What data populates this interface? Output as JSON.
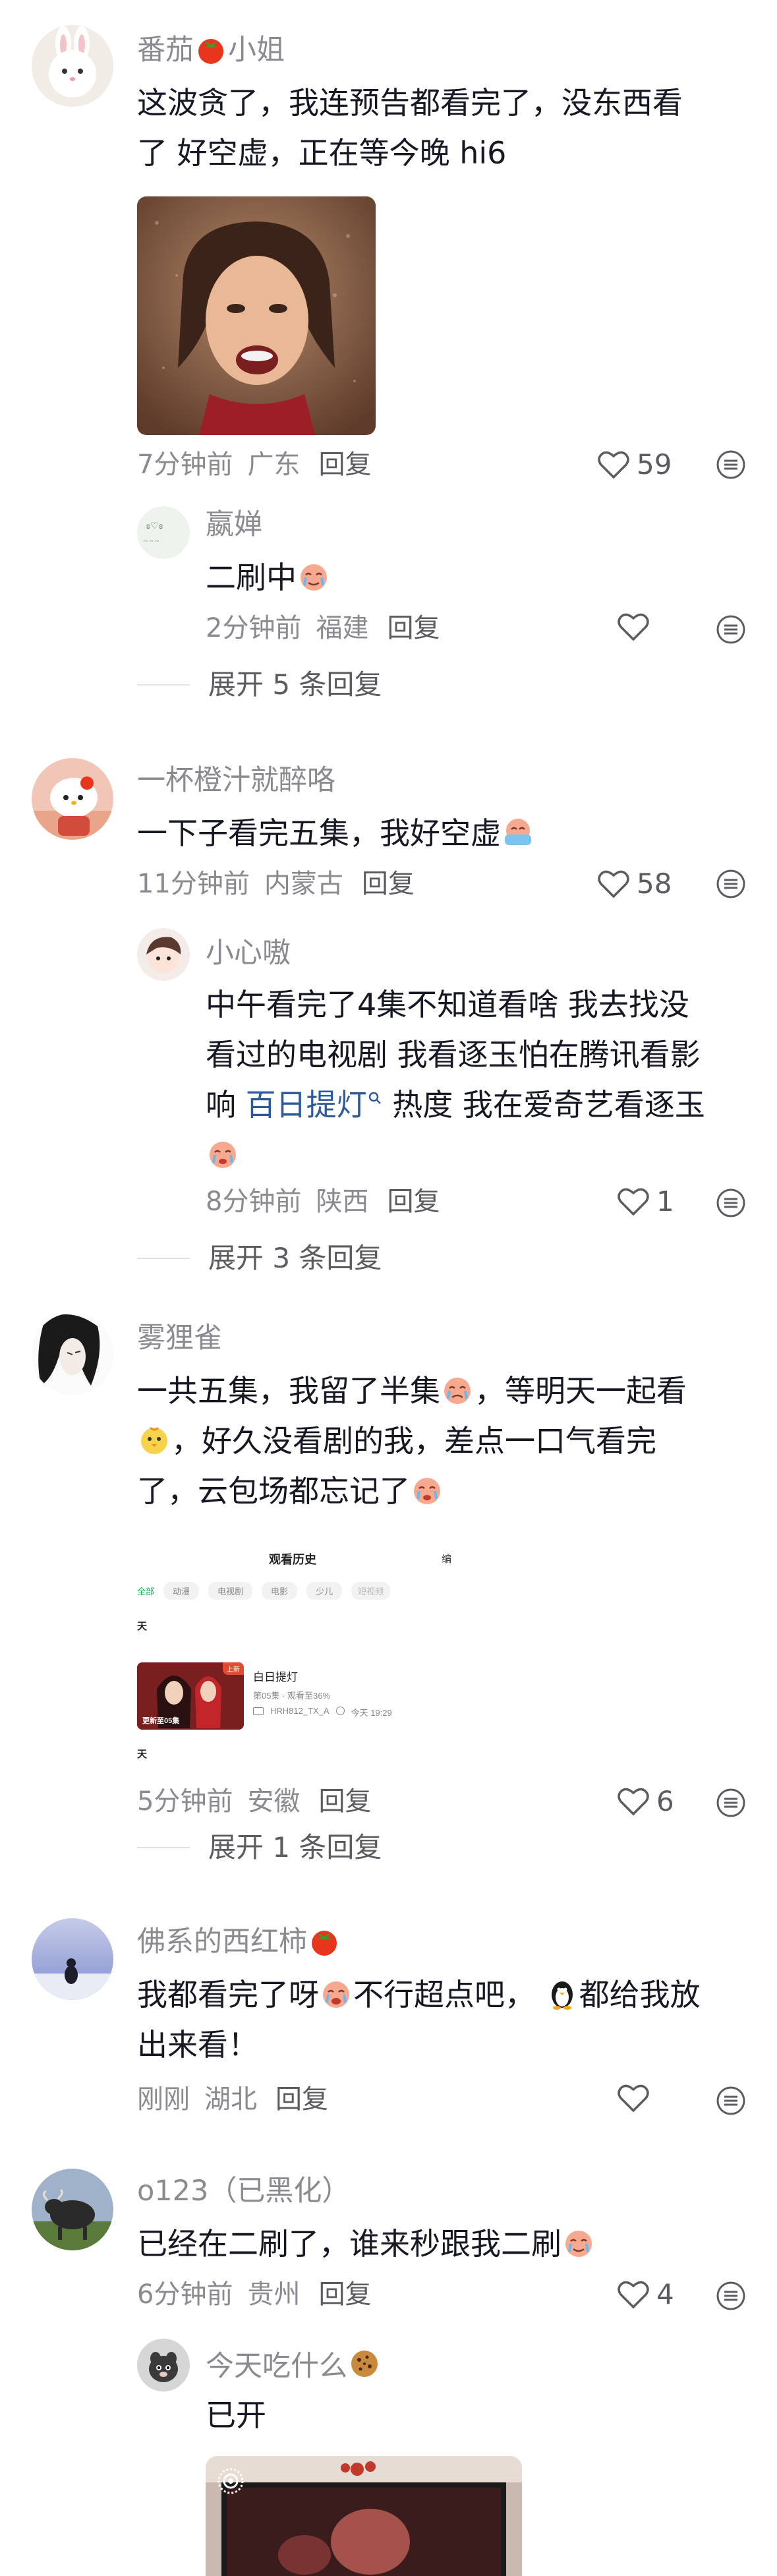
{
  "comments": [
    {
      "username": "番茄",
      "username_suffix": "小姐",
      "text_line1": "这波贪了，我连预告都看完了，没东西看",
      "text_line2": "了 好空虚，正在等今晚 hi6",
      "time": "7分钟前",
      "location": "广东",
      "reply_label": "回复",
      "likes": "59"
    },
    {
      "username": "一杯橙汁就醉咯",
      "text": "一下子看完五集，我好空虚",
      "time": "11分钟前",
      "location": "内蒙古",
      "reply_label": "回复",
      "likes": "58"
    },
    {
      "username": "雾狸雀",
      "text_line1": "一共五集，我留了半集",
      "text_line1b": "，等明天一起看",
      "text_line2": "，好久没看剧的我，差点一口气看完",
      "text_line3": "了，云包场都忘记了",
      "time": "5分钟前",
      "location": "安徽",
      "reply_label": "回复",
      "likes": "6"
    },
    {
      "username": "佛系的西红柿",
      "text_line1a": "我都看完了呀",
      "text_line1b": "不行超点吧，",
      "text_line1c": "都给我放",
      "text_line2": "出来看！",
      "time": "刚刚",
      "location": "湖北",
      "reply_label": "回复"
    },
    {
      "username": "o123（已黑化）",
      "text": "已经在二刷了，谁来秒跟我二刷",
      "time": "6分钟前",
      "location": "贵州",
      "reply_label": "回复",
      "likes": "4"
    }
  ],
  "replies": [
    {
      "username": "嬴婵",
      "text": "二刷中",
      "time": "2分钟前",
      "location": "福建",
      "reply_label": "回复"
    },
    {
      "username": "小心嗷",
      "text_line1": "中午看完了4集不知道看啥 我去找没",
      "text_line2": "看过的电视剧  我看逐玉怕在腾讯看影",
      "text_line3a": "响",
      "text_link": "百日提灯",
      "text_line3b": "热度 我在爱奇艺看逐玉",
      "time": "8分钟前",
      "location": "陕西",
      "reply_label": "回复",
      "likes": "1"
    },
    {
      "username": "今天吃什么",
      "text": "已开"
    }
  ],
  "expand": [
    "展开 5 条回复",
    "展开 3 条回复",
    "展开 1 条回复"
  ],
  "screenshot": {
    "title": "观看历史",
    "edit": "编",
    "tabs": [
      "全部",
      "动漫",
      "电视剧",
      "电影",
      "少儿",
      "短视频"
    ],
    "day1": "天",
    "day2": "天",
    "show_title": "白日提灯",
    "show_progress": "第05集 · 观看至36%",
    "device": "HRH812_TX_A",
    "watch_time": "今天 19:29",
    "badge": "更新至05集",
    "vip": "上新"
  },
  "colors": {
    "name_gray": "#8a8b91",
    "text_dark": "#161823",
    "link_blue": "#2d5b9c",
    "tomato_red": "#e8361d"
  }
}
